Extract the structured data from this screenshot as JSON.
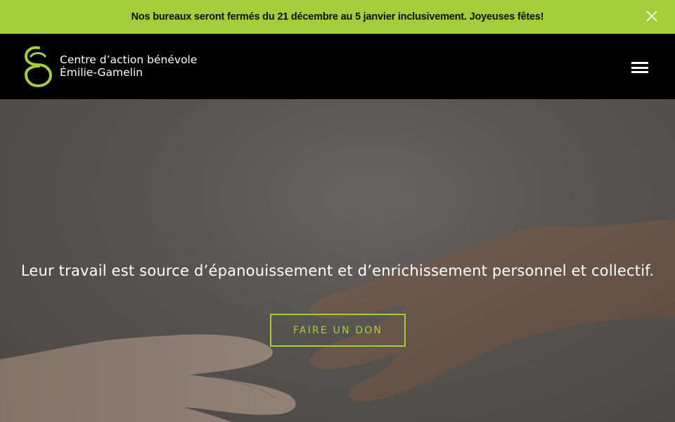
{
  "announcement": {
    "text": "Nos bureaux seront fermés du 21 décembre au 5 janvier inclusivement. Joyeuses fêtes!",
    "close_icon": "close-icon"
  },
  "header": {
    "logo_line1": "Centre d’action bénévole",
    "logo_line2": "Émilie-Gamelin",
    "menu_icon": "hamburger-menu-icon"
  },
  "hero": {
    "tagline": "Leur travail est source d’épanouissement et d’enrichissement personnel et collectif.",
    "cta_label": "FAIRE UN DON",
    "image_subject": "two hands reaching toward each other"
  },
  "colors": {
    "accent": "#a4cd3c",
    "header_bg": "#000000",
    "text_light": "#ffffff"
  }
}
